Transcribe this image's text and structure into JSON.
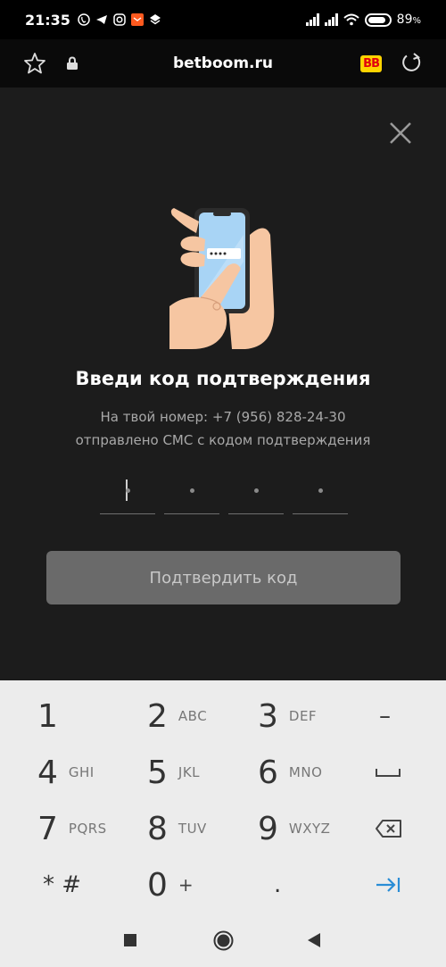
{
  "status_bar": {
    "time": "21:35",
    "battery_percent_text": "89",
    "battery_unit": "%",
    "battery_level": 0.89
  },
  "address_bar": {
    "url": "betboom.ru",
    "logo_text": "BB"
  },
  "dialog": {
    "title": "Введи код подтверждения",
    "subtitle_line1": "На твой номер: +7 (956) 828-24-30",
    "subtitle_line2": "отправлено СМС с кодом подтверждения",
    "code_digits": [
      "",
      "",
      "",
      ""
    ],
    "confirm_label": "Подтвердить код"
  },
  "keypad": {
    "keys": [
      {
        "num": "1",
        "letters": ""
      },
      {
        "num": "2",
        "letters": "ABC"
      },
      {
        "num": "3",
        "letters": "DEF"
      },
      {
        "num": "4",
        "letters": "GHI"
      },
      {
        "num": "5",
        "letters": "JKL"
      },
      {
        "num": "6",
        "letters": "MNO"
      },
      {
        "num": "7",
        "letters": "PQRS"
      },
      {
        "num": "8",
        "letters": "TUV"
      },
      {
        "num": "9",
        "letters": "WXYZ"
      },
      {
        "num": "0",
        "letters": "+"
      }
    ],
    "minus": "–",
    "star_hash": "* #",
    "dot": "."
  },
  "colors": {
    "accent_blue": "#2a8dd6",
    "page_bg": "#1c1c1c",
    "button_bg": "#6a6a6a"
  }
}
